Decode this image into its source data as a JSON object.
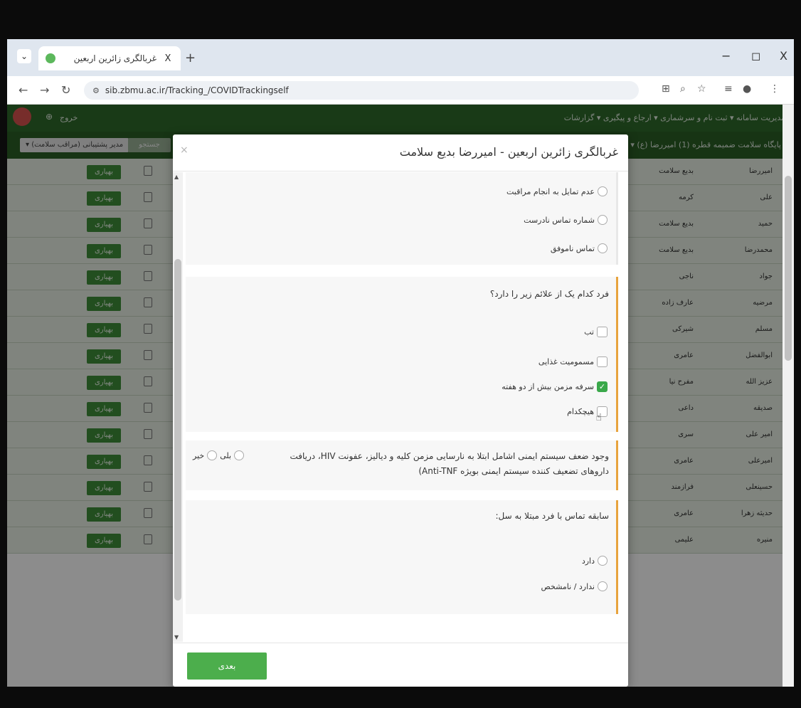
{
  "browser": {
    "tab_title": "غربالگری زائرین اربعین",
    "url": "sib.zbmu.ac.ir/Tracking_/COVIDTrackingself",
    "tab_close": "X",
    "new_tab": "+",
    "minimize": "−",
    "restore": "◻",
    "close": "X"
  },
  "topnav": {
    "exit_label": "خروج",
    "menu_text": "مدیریت سامانه ▾ ثبت نام و سرشماری ▾ ارجاع و پیگیری ▾ گزارشات"
  },
  "subnav": {
    "selected_unit": "پایگاه سلامت ضمیمه قطره (1) امیررضا (ع) ▾",
    "left_button": "مدیر پشتیبانی (مراقب سلامت) ▾",
    "search_button": "جستجو"
  },
  "grid": {
    "row_button_label": "بهیاری",
    "rows": [
      {
        "first": "امیررضا",
        "last": "بدیع سلامت"
      },
      {
        "first": "علی",
        "last": "کرمه"
      },
      {
        "first": "حمید",
        "last": "بدیع سلامت"
      },
      {
        "first": "محمدرضا",
        "last": "بدیع سلامت"
      },
      {
        "first": "جواد",
        "last": "ناجی"
      },
      {
        "first": "مرضیه",
        "last": "عارف زاده"
      },
      {
        "first": "مسلم",
        "last": "شیرکی"
      },
      {
        "first": "ابوالفضل",
        "last": "عامری"
      },
      {
        "first": "عزیز الله",
        "last": "مفرح نیا"
      },
      {
        "first": "صدیقه",
        "last": "داعی"
      },
      {
        "first": "امیر علی",
        "last": "سری"
      },
      {
        "first": "امیرعلی",
        "last": "عامری"
      },
      {
        "first": "حسینعلی",
        "last": "فرازمند"
      },
      {
        "first": "حدیثه زهرا",
        "last": "عامری"
      },
      {
        "first": "منیره",
        "last": "علیمی"
      }
    ]
  },
  "modal": {
    "title": "غربالگری زائرین اربعین - امیررضا بدیع سلامت",
    "close": "×",
    "section1": {
      "options": [
        "عدم تمایل به انجام مراقبت",
        "شماره تماس نادرست",
        "تماس ناموفق"
      ]
    },
    "section2": {
      "question": "فرد کدام یک از علائم زیر را دارد؟",
      "options": [
        {
          "label": "تب",
          "checked": false
        },
        {
          "label": "مسمومیت غذایی",
          "checked": false
        },
        {
          "label": "سرفه مزمن بیش از دو هفته",
          "checked": true
        },
        {
          "label": "هیچکدام",
          "checked": false
        }
      ]
    },
    "section3": {
      "question": "وجود ضعف سیستم ایمنی اشامل ابتلا به نارسایی مزمن کلیه و دیالیز، عفونت HIV، دریافت داروهای تضعیف کننده سیستم ایمنی بویژه Anti-TNF)",
      "yes": "بلی",
      "no": "خیر"
    },
    "section4": {
      "question": "سابقه تماس با فرد مبتلا به سل:",
      "options": [
        "دارد",
        "ندارد / نامشخص"
      ]
    },
    "next_button": "بعدی"
  }
}
